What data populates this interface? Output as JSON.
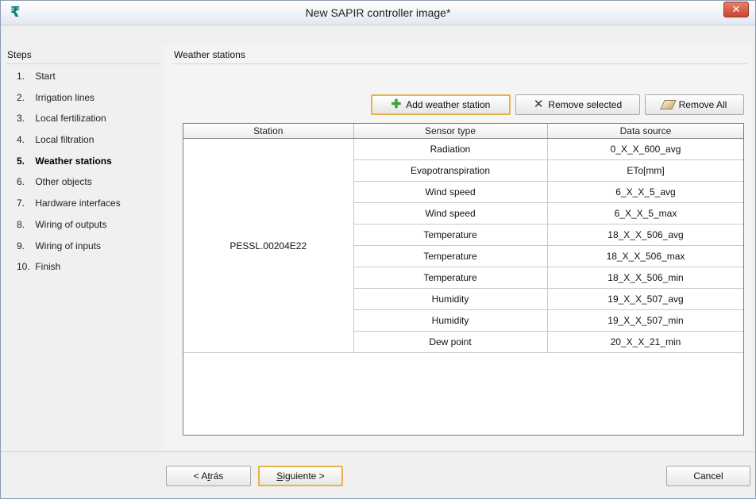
{
  "window": {
    "title": "New SAPIR controller image*",
    "app_icon": "₹",
    "close_glyph": "✕"
  },
  "steps": {
    "header": "Steps",
    "items": [
      {
        "num": "1.",
        "label": "Start"
      },
      {
        "num": "2.",
        "label": "Irrigation lines"
      },
      {
        "num": "3.",
        "label": "Local fertilization"
      },
      {
        "num": "4.",
        "label": "Local filtration"
      },
      {
        "num": "5.",
        "label": "Weather stations"
      },
      {
        "num": "6.",
        "label": "Other objects"
      },
      {
        "num": "7.",
        "label": "Hardware interfaces"
      },
      {
        "num": "8.",
        "label": "Wiring of outputs"
      },
      {
        "num": "9.",
        "label": "Wiring of inputs"
      },
      {
        "num": "10.",
        "label": "Finish"
      }
    ],
    "active_index": 4
  },
  "content": {
    "header": "Weather stations",
    "toolbar": {
      "add_label": "Add weather station",
      "remove_selected_label": "Remove selected",
      "remove_all_label": "Remove All"
    },
    "table": {
      "columns": [
        "Station",
        "Sensor type",
        "Data source"
      ],
      "station": "PESSL.00204E22",
      "rows": [
        {
          "sensor": "Radiation",
          "source": "0_X_X_600_avg"
        },
        {
          "sensor": "Evapotranspiration",
          "source": "ETo[mm]"
        },
        {
          "sensor": "Wind speed",
          "source": "6_X_X_5_avg"
        },
        {
          "sensor": "Wind speed",
          "source": "6_X_X_5_max"
        },
        {
          "sensor": "Temperature",
          "source": "18_X_X_506_avg"
        },
        {
          "sensor": "Temperature",
          "source": "18_X_X_506_max"
        },
        {
          "sensor": "Temperature",
          "source": "18_X_X_506_min"
        },
        {
          "sensor": "Humidity",
          "source": "19_X_X_507_avg"
        },
        {
          "sensor": "Humidity",
          "source": "19_X_X_507_min"
        },
        {
          "sensor": "Dew point",
          "source": "20_X_X_21_min"
        }
      ]
    }
  },
  "footer": {
    "back": {
      "prefix": "< A",
      "mnemonic": "t",
      "suffix": "rás"
    },
    "next": {
      "prefix": "",
      "mnemonic": "S",
      "suffix": "iguiente >"
    },
    "cancel_label": "Cancel"
  },
  "icons": {
    "add": "plus-icon",
    "remove_selected": "x-icon",
    "remove_all": "eraser-icon"
  },
  "colors": {
    "close_button": "#c7452f",
    "focus_border": "#e9b14a",
    "add_icon": "#3fa33a"
  }
}
